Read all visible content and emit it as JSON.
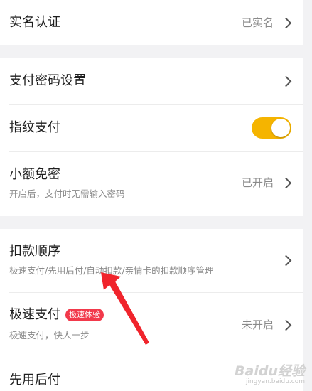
{
  "real_name": {
    "title": "实名认证",
    "status": "已实名"
  },
  "payment_password": {
    "title": "支付密码设置"
  },
  "fingerprint": {
    "title": "指纹支付",
    "enabled": true
  },
  "small_amount": {
    "title": "小额免密",
    "subtitle": "开启后，支付时无需输入密码",
    "status": "已开启"
  },
  "deduction_order": {
    "title": "扣款顺序",
    "subtitle": "极速支付/先用后付/自动扣款/亲情卡的扣款顺序管理"
  },
  "express_pay": {
    "title": "极速支付",
    "badge": "极速体验",
    "subtitle": "极速支付，快人一步",
    "status": "未开启"
  },
  "pay_later": {
    "title": "先用后付"
  },
  "colors": {
    "toggle_on": "#f5b400",
    "badge": "#f2394b",
    "annotation_arrow": "#f0242c"
  },
  "watermark": {
    "logo": "Baidu经验",
    "url": "jingyan.baidu.com"
  }
}
